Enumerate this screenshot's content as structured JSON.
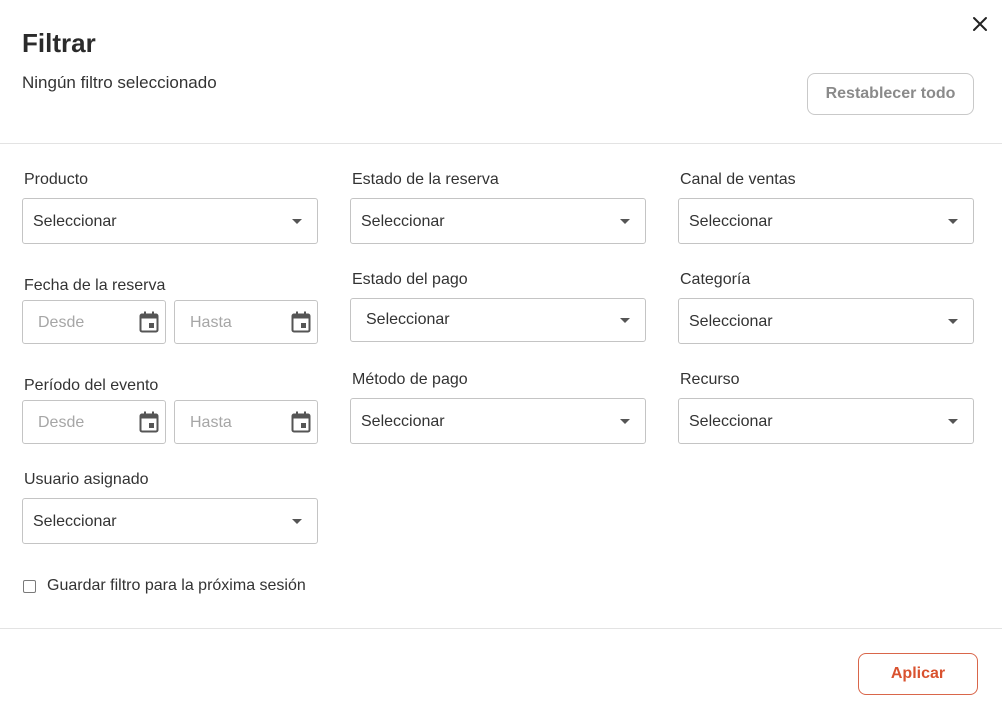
{
  "header": {
    "title": "Filtrar",
    "subtitle": "Ningún filtro seleccionado",
    "reset_label": "Restablecer todo",
    "close_icon": "close-icon"
  },
  "filters": {
    "producto": {
      "label": "Producto",
      "value": "Seleccionar"
    },
    "estado_reserva": {
      "label": "Estado de la reserva",
      "value": "Seleccionar"
    },
    "canal_ventas": {
      "label": "Canal de ventas",
      "value": "Seleccionar"
    },
    "fecha_reserva": {
      "label": "Fecha de la reserva",
      "from_placeholder": "Desde",
      "to_placeholder": "Hasta"
    },
    "estado_pago": {
      "label": "Estado del pago",
      "value": "Seleccionar"
    },
    "categoria": {
      "label": "Categoría",
      "value": "Seleccionar"
    },
    "periodo_evento": {
      "label": "Período del evento",
      "from_placeholder": "Desde",
      "to_placeholder": "Hasta"
    },
    "metodo_pago": {
      "label": "Método de pago",
      "value": "Seleccionar"
    },
    "recurso": {
      "label": "Recurso",
      "value": "Seleccionar"
    },
    "usuario_asignado": {
      "label": "Usuario asignado",
      "value": "Seleccionar"
    }
  },
  "save_filter": {
    "label": "Guardar filtro para la próxima sesión",
    "checked": false
  },
  "footer": {
    "apply_label": "Aplicar"
  },
  "colors": {
    "accent": "#d9522f",
    "border": "#c4c4c4",
    "text": "#333333",
    "placeholder": "#a6a6a6"
  },
  "icons": {
    "dropdown": "chevron-down-icon",
    "calendar": "calendar-icon",
    "close": "close-icon"
  }
}
